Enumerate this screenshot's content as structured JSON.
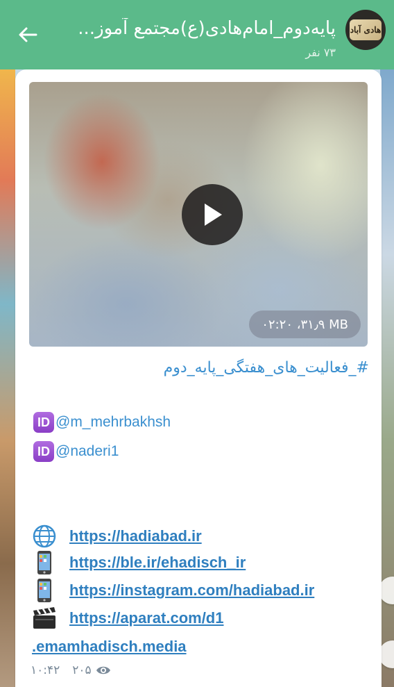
{
  "header": {
    "back_label": "back",
    "title": "پایه‌دوم_امام‌هادی(ع)مجتمع آموز...",
    "subtitle": "۷۳ نفر",
    "avatar_text": "هادی آباد",
    "color": "#5bba8a"
  },
  "message": {
    "video": {
      "meta": "۰۲:۲۰ ،۳۱٫۹ MB",
      "play_icon": "play-icon"
    },
    "hashtag": "#_فعالیت_های_هفتگی_پایه_دوم",
    "mentions": [
      {
        "badge": "ID",
        "handle": "@m_mehrbakhsh"
      },
      {
        "badge": "ID",
        "handle": "@naderi1"
      }
    ],
    "links": [
      {
        "icon": "globe-icon",
        "glyph": "🌐",
        "url": "https://hadiabad.ir"
      },
      {
        "icon": "phone-icon",
        "glyph": "📱",
        "url": "https://ble.ir/ehadisch_ir"
      },
      {
        "icon": "phone-icon",
        "glyph": "📱",
        "url": "https://instagram.com/hadiabad.ir"
      },
      {
        "icon": "clapper-icon",
        "glyph": "🎬",
        "url": "https://aparat.com/d1"
      }
    ],
    "link_continuation": ".emamhadisch.media",
    "time": "۱۰:۴۲",
    "views": "۲۰۵"
  },
  "colors": {
    "link": "#2f7fbf",
    "mention": "#3a8fcf",
    "id_badge": "#9b4fd6"
  }
}
